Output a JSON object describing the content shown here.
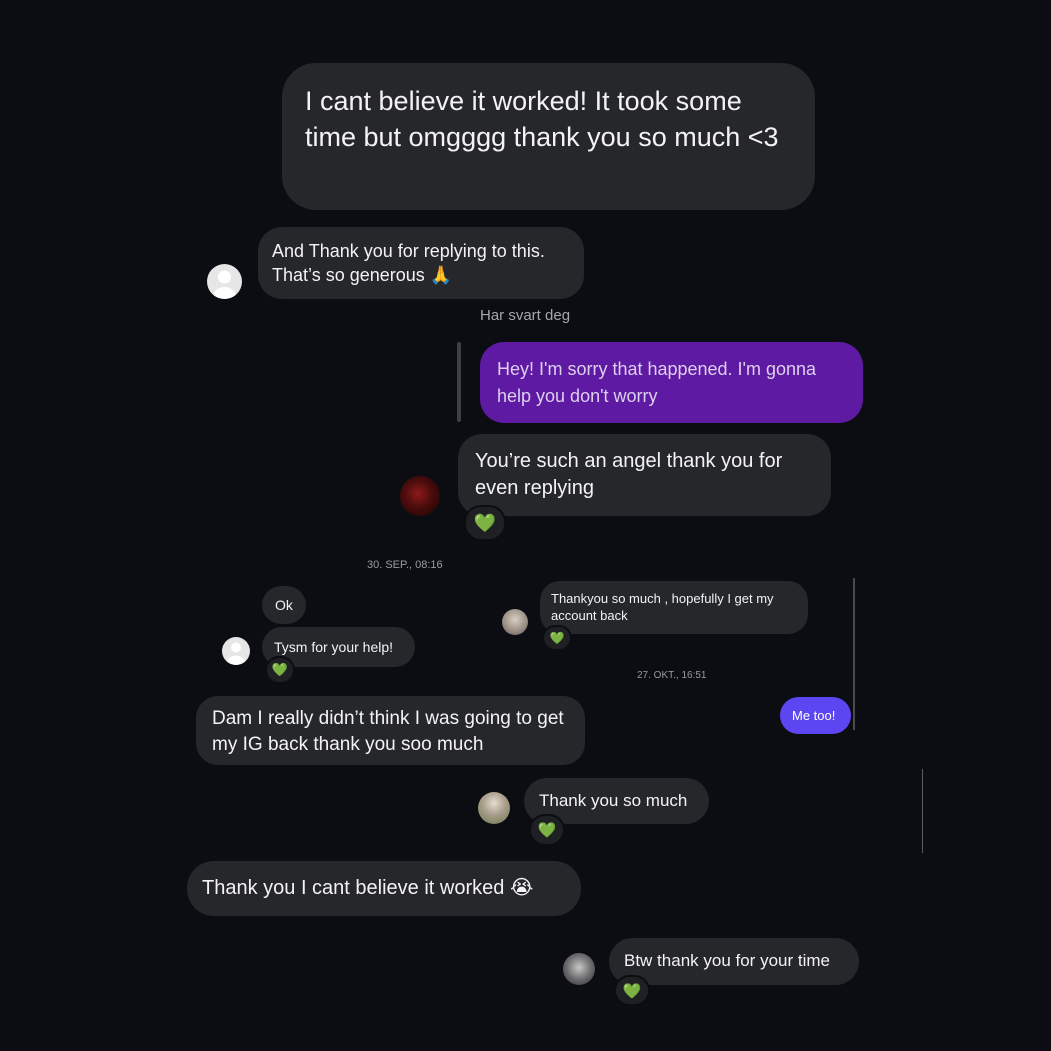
{
  "messages": {
    "m1": "I cant believe it worked! It took some time but omgggg thank you so much <3",
    "m2": "And Thank you for replying to this. That’s so generous 🙏",
    "reply_label": "Har svart deg",
    "m3": "Hey! I'm sorry that happened. I'm gonna help you don't worry",
    "m4": "You’re such an angel thank you for even replying",
    "timestamp1": "30. SEP., 08:16",
    "m5": "Ok",
    "m6": "Tysm for your help!",
    "m7": "Thankyou so much , hopefully I get my account back",
    "timestamp2": "27. OKT., 16:51",
    "m8": "Me too!",
    "m9": "Dam I really didn’t think I was going to get my IG back thank you soo much",
    "m10": "Thank you so much",
    "m11": "Thank you I cant believe it worked 😭",
    "m12": "Btw thank you for your time"
  },
  "reactions": {
    "heart": "💚"
  },
  "colors": {
    "background": "#0b0d12",
    "bubble_gray": "#26272b",
    "bubble_purple": "#5f1aa3",
    "bubble_blue": "#5b46f2"
  },
  "icons": {
    "avatar_default": "default-avatar-icon",
    "reaction": "green-heart-icon"
  }
}
